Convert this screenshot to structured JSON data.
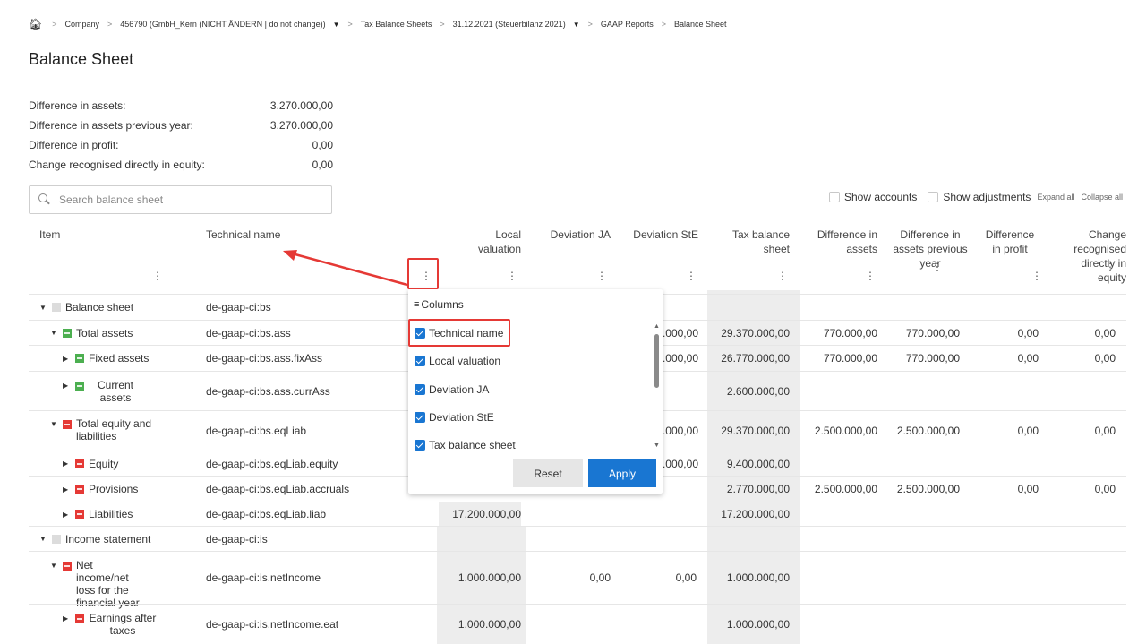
{
  "breadcrumb": {
    "home_icon": "home-icon",
    "items": [
      "Company",
      "456790 (GmbH_Kern (NICHT ÄNDERN | do not change))",
      "Tax Balance Sheets",
      "31.12.2021 (Steuerbilanz 2021)",
      "GAAP Reports",
      "Balance Sheet"
    ]
  },
  "page": {
    "title": "Balance Sheet"
  },
  "summary": [
    {
      "label": "Difference in assets:",
      "value": "3.270.000,00"
    },
    {
      "label": "Difference in assets previous year:",
      "value": "3.270.000,00"
    },
    {
      "label": "Difference in profit:",
      "value": "0,00"
    },
    {
      "label": "Change recognised directly in equity:",
      "value": "0,00"
    }
  ],
  "search": {
    "placeholder": "Search balance sheet"
  },
  "toolbar": {
    "show_accounts": "Show accounts",
    "show_adjustments": "Show adjustments",
    "expand_all": "Expand all",
    "collapse_all": "Collapse all"
  },
  "columns": [
    {
      "label": "Item"
    },
    {
      "label": "Technical name"
    },
    {
      "label": "Local valuation"
    },
    {
      "label": "Deviation JA"
    },
    {
      "label": "Deviation StE"
    },
    {
      "label": "Tax balance sheet"
    },
    {
      "label": "Difference in assets"
    },
    {
      "label": "Difference in assets previous year"
    },
    {
      "label": "Difference in profit"
    },
    {
      "label": "Change recognised directly in equity"
    }
  ],
  "kebab": "⋮",
  "rows": [
    {
      "item": "Balance sheet",
      "tech": "de-gaap-ci:bs",
      "local": "",
      "ja": "",
      "ste": "",
      "tax": "",
      "da": "",
      "dapy": "",
      "dp": "",
      "eq": ""
    },
    {
      "item": "Total assets",
      "tech": "de-gaap-ci:bs.ass",
      "local": "",
      "ja": "",
      "ste": ".000,00",
      "tax": "29.370.000,00",
      "da": "770.000,00",
      "dapy": "770.000,00",
      "dp": "0,00",
      "eq": "0,00"
    },
    {
      "item": "Fixed assets",
      "tech": "de-gaap-ci:bs.ass.fixAss",
      "local": "",
      "ja": "",
      "ste": ".000,00",
      "tax": "26.770.000,00",
      "da": "770.000,00",
      "dapy": "770.000,00",
      "dp": "0,00",
      "eq": "0,00"
    },
    {
      "item": "Current assets",
      "tech": "de-gaap-ci:bs.ass.currAss",
      "local": "",
      "ja": "",
      "ste": "",
      "tax": "2.600.000,00",
      "da": "",
      "dapy": "",
      "dp": "",
      "eq": ""
    },
    {
      "item": "Total equity and liabilities",
      "tech": "de-gaap-ci:bs.eqLiab",
      "local": "",
      "ja": "",
      "ste": ".000,00",
      "tax": "29.370.000,00",
      "da": "2.500.000,00",
      "dapy": "2.500.000,00",
      "dp": "0,00",
      "eq": "0,00"
    },
    {
      "item": "Equity",
      "tech": "de-gaap-ci:bs.eqLiab.equity",
      "local": "",
      "ja": "",
      "ste": ".000,00",
      "tax": "9.400.000,00",
      "da": "",
      "dapy": "",
      "dp": "",
      "eq": ""
    },
    {
      "item": "Provisions",
      "tech": "de-gaap-ci:bs.eqLiab.accruals",
      "local": "",
      "ja": "",
      "ste": "",
      "tax": "2.770.000,00",
      "da": "2.500.000,00",
      "dapy": "2.500.000,00",
      "dp": "0,00",
      "eq": "0,00"
    },
    {
      "item": "Liabilities",
      "tech": "de-gaap-ci:bs.eqLiab.liab",
      "local": "17.200.000,00",
      "ja": "",
      "ste": "",
      "tax": "17.200.000,00",
      "da": "",
      "dapy": "",
      "dp": "",
      "eq": ""
    },
    {
      "item": "Income statement",
      "tech": "de-gaap-ci:is",
      "local": "",
      "ja": "",
      "ste": "",
      "tax": "",
      "da": "",
      "dapy": "",
      "dp": "",
      "eq": ""
    },
    {
      "item": "Net income/net loss for the financial year",
      "tech": "de-gaap-ci:is.netIncome",
      "local": "1.000.000,00",
      "ja": "0,00",
      "ste": "0,00",
      "tax": "1.000.000,00",
      "da": "",
      "dapy": "",
      "dp": "",
      "eq": ""
    },
    {
      "item": "Earnings after taxes",
      "tech": "de-gaap-ci:is.netIncome.eat",
      "local": "1.000.000,00",
      "ja": "",
      "ste": "",
      "tax": "1.000.000,00",
      "da": "",
      "dapy": "",
      "dp": "",
      "eq": ""
    }
  ],
  "column_menu": {
    "title": "Columns",
    "title_icon": "columns-icon",
    "items": [
      {
        "label": "Technical name",
        "checked": true
      },
      {
        "label": "Local valuation",
        "checked": true
      },
      {
        "label": "Deviation JA",
        "checked": true
      },
      {
        "label": "Deviation StE",
        "checked": true
      },
      {
        "label": "Tax balance sheet",
        "checked": true
      }
    ],
    "reset": "Reset",
    "apply": "Apply"
  },
  "colors": {
    "accent": "#1976d2",
    "annotation": "#e53935",
    "shade": "#ededed"
  }
}
